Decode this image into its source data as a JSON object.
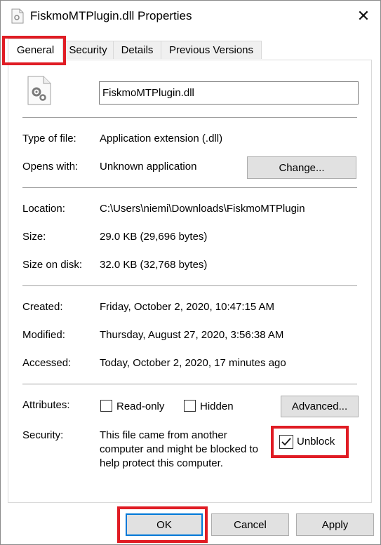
{
  "window": {
    "title": "FiskmoMTPlugin.dll Properties"
  },
  "tabs": [
    {
      "label": "General",
      "active": true
    },
    {
      "label": "Security",
      "active": false
    },
    {
      "label": "Details",
      "active": false
    },
    {
      "label": "Previous Versions",
      "active": false
    }
  ],
  "file": {
    "name": "FiskmoMTPlugin.dll",
    "icon": "dll-gear-icon"
  },
  "details": {
    "type_label": "Type of file:",
    "type_value": "Application extension (.dll)",
    "opens_label": "Opens with:",
    "opens_value": "Unknown application",
    "change_button": "Change...",
    "location_label": "Location:",
    "location_value": "C:\\Users\\niemi\\Downloads\\FiskmoMTPlugin",
    "size_label": "Size:",
    "size_value": "29.0 KB (29,696 bytes)",
    "size_on_disk_label": "Size on disk:",
    "size_on_disk_value": "32.0 KB (32,768 bytes)",
    "created_label": "Created:",
    "created_value": "Friday, October 2, 2020, 10:47:15 AM",
    "modified_label": "Modified:",
    "modified_value": "Thursday, August 27, 2020, 3:56:38 AM",
    "accessed_label": "Accessed:",
    "accessed_value": "Today, October 2, 2020, 17 minutes ago"
  },
  "attributes": {
    "label": "Attributes:",
    "readonly_label": "Read-only",
    "readonly_checked": false,
    "hidden_label": "Hidden",
    "hidden_checked": false,
    "advanced_button": "Advanced..."
  },
  "security": {
    "label": "Security:",
    "line1": "This file came from another",
    "line2": "computer and might be blocked to",
    "line3": "help protect this computer.",
    "unblock_label": "Unblock",
    "unblock_checked": true
  },
  "footer": {
    "ok": "OK",
    "cancel": "Cancel",
    "apply": "Apply"
  },
  "colors": {
    "highlight": "#e01c24",
    "focus": "#0078d7"
  }
}
